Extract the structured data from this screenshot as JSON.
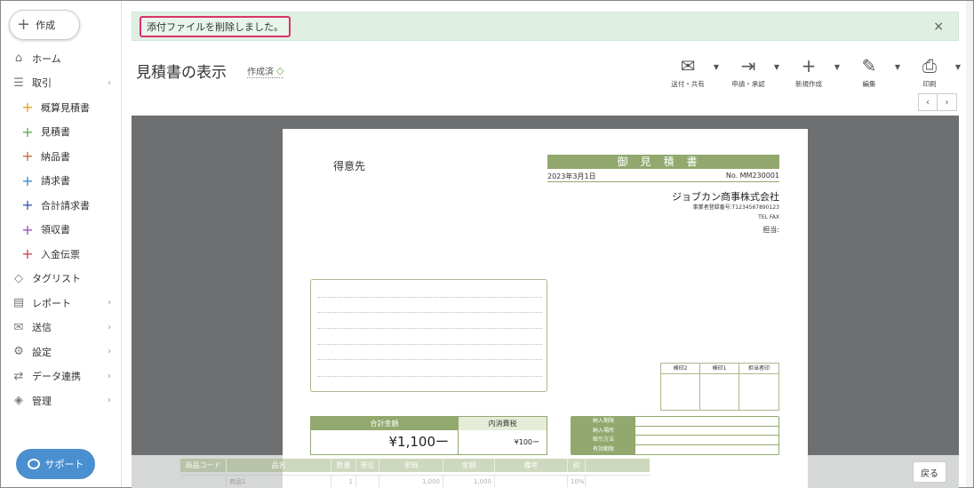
{
  "sidebar": {
    "create_label": "作成",
    "items": [
      {
        "label": "ホーム",
        "icon": "home-icon",
        "glyph": "⌂",
        "chev": ""
      },
      {
        "label": "取引",
        "icon": "list-icon",
        "glyph": "☰",
        "chev": "›"
      },
      {
        "label": "概算見積書",
        "icon": "plus-icon",
        "glyph": "+",
        "color": "#e5a321",
        "sub": true
      },
      {
        "label": "見積書",
        "icon": "plus-icon",
        "glyph": "+",
        "color": "#6aa84f",
        "sub": true
      },
      {
        "label": "納品書",
        "icon": "plus-icon",
        "glyph": "+",
        "color": "#c0703f",
        "sub": true
      },
      {
        "label": "請求書",
        "icon": "plus-icon",
        "glyph": "+",
        "color": "#3d8fd1",
        "sub": true
      },
      {
        "label": "合計請求書",
        "icon": "plus-icon",
        "glyph": "+",
        "color": "#3a5ea8",
        "sub": true
      },
      {
        "label": "領収書",
        "icon": "plus-icon",
        "glyph": "+",
        "color": "#9c4fc0",
        "sub": true
      },
      {
        "label": "入金伝票",
        "icon": "plus-icon",
        "glyph": "+",
        "color": "#d2405a",
        "sub": true
      },
      {
        "label": "タグリスト",
        "icon": "tag-icon",
        "glyph": "◇",
        "chev": ""
      },
      {
        "label": "レポート",
        "icon": "report-icon",
        "glyph": "▤",
        "chev": "›"
      },
      {
        "label": "送信",
        "icon": "mail-icon",
        "glyph": "✉",
        "chev": "›"
      },
      {
        "label": "設定",
        "icon": "gear-icon",
        "glyph": "⚙",
        "chev": "›"
      },
      {
        "label": "データ連携",
        "icon": "sync-icon",
        "glyph": "⇄",
        "chev": "›"
      },
      {
        "label": "管理",
        "icon": "layers-icon",
        "glyph": "◈",
        "chev": "›"
      }
    ],
    "support_label": "サポート"
  },
  "notice": {
    "message": "添付ファイルを削除しました。",
    "close": "×"
  },
  "header": {
    "title": "見積書の表示",
    "status": "作成済"
  },
  "toolbar": [
    {
      "label": "送付・共有",
      "icon": "mail-icon",
      "glyph": "✉"
    },
    {
      "label": "申請・承認",
      "icon": "login-icon",
      "glyph": "⇥"
    },
    {
      "label": "新規作成",
      "icon": "plus-icon",
      "glyph": "+"
    },
    {
      "label": "編集",
      "icon": "pencil-icon",
      "glyph": "✎"
    },
    {
      "label": "印刷",
      "icon": "printer-icon",
      "glyph": "⎙"
    }
  ],
  "pager": {
    "prev": "‹",
    "next": "›"
  },
  "document": {
    "client_label": "得意先",
    "title": "御見積書",
    "date": "2023年3月1日",
    "number": "No. MM230001",
    "company": "ジョブカン商事株式会社",
    "registration": "事業者登録番号:T1234567890123",
    "tel_fax": "TEL FAX",
    "staff": "担当:",
    "stamps": [
      "検印2",
      "検印1",
      "担当者印"
    ],
    "total_label": "合計金額",
    "tax_label": "内消費税",
    "total_value": "¥1,100ー",
    "tax_value": "¥100ー",
    "delivery_rows": [
      "納入期限",
      "納入場所",
      "取引方法",
      "有効期限"
    ]
  },
  "table": {
    "headers": [
      "商品コード",
      "品名",
      "数量",
      "単位",
      "単価",
      "金額",
      "備考",
      "税"
    ],
    "row": [
      "",
      "商品1",
      "1",
      "",
      "1,000",
      "1,000",
      "",
      "10%"
    ]
  },
  "back_label": "戻る"
}
